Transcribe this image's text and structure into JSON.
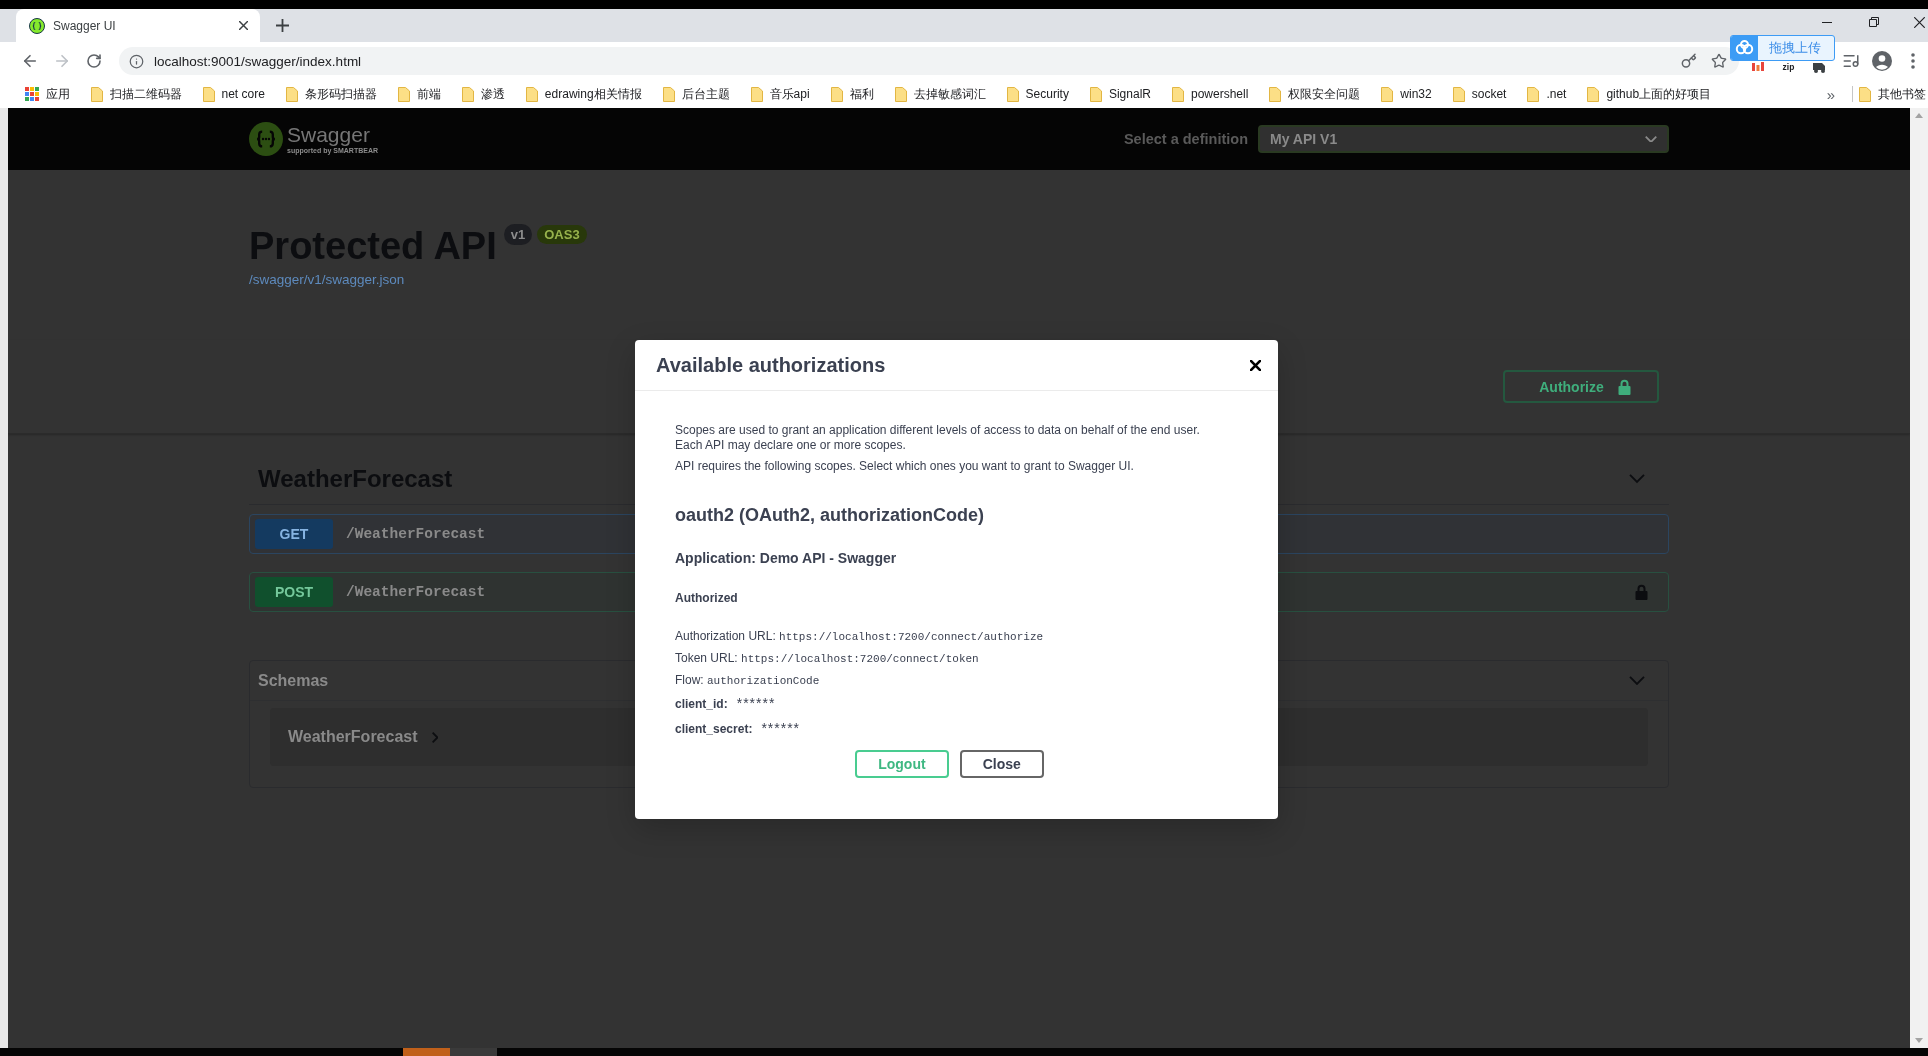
{
  "browser": {
    "tabs": [
      {
        "title": "Swagger UI",
        "selected": true
      }
    ],
    "url": "localhost:9001/swagger/index.html",
    "extension_label": "zip",
    "upload_widget": {
      "label": "拖拽上传"
    }
  },
  "bookmarks": {
    "items": [
      {
        "label": "应用",
        "kind": "apps"
      },
      {
        "label": "扫描二维码器",
        "kind": "folder"
      },
      {
        "label": "net core",
        "kind": "folder"
      },
      {
        "label": "条形码扫描器",
        "kind": "folder"
      },
      {
        "label": "前端",
        "kind": "folder"
      },
      {
        "label": "渗透",
        "kind": "folder"
      },
      {
        "label": "edrawing相关情报",
        "kind": "folder"
      },
      {
        "label": "后台主题",
        "kind": "folder"
      },
      {
        "label": "音乐api",
        "kind": "folder"
      },
      {
        "label": "福利",
        "kind": "folder"
      },
      {
        "label": "去掉敏感词汇",
        "kind": "folder"
      },
      {
        "label": "Security",
        "kind": "folder"
      },
      {
        "label": "SignalR",
        "kind": "folder"
      },
      {
        "label": "powershell",
        "kind": "folder"
      },
      {
        "label": "权限安全问题",
        "kind": "folder"
      },
      {
        "label": "win32",
        "kind": "folder"
      },
      {
        "label": "socket",
        "kind": "folder"
      },
      {
        "label": ".net",
        "kind": "folder"
      },
      {
        "label": "github上面的好项目",
        "kind": "folder"
      }
    ],
    "overflow": "»",
    "other": {
      "label": "其他书签",
      "kind": "folder"
    }
  },
  "swagger": {
    "topbar": {
      "logo_text": "Swagger",
      "logo_tagline": "supported by SMARTBEAR",
      "definition_label": "Select a definition",
      "definition_value": "My API V1"
    },
    "info": {
      "title": "Protected API",
      "version": "v1",
      "spec": "OAS3",
      "spec_url": "/swagger/v1/swagger.json"
    },
    "authorize_button": {
      "label": "Authorize"
    },
    "tags": [
      {
        "name": "WeatherForecast",
        "expanded": true,
        "operations": [
          {
            "kind": "get",
            "method": "GET",
            "path": "/WeatherForecast",
            "locked": false
          },
          {
            "kind": "post",
            "method": "POST",
            "path": "/WeatherForecast",
            "locked": true
          }
        ]
      }
    ],
    "schemas": {
      "title": "Schemas",
      "expanded": true,
      "models": [
        {
          "name": "WeatherForecast",
          "expanded": false
        }
      ]
    }
  },
  "modal": {
    "title": "Available authorizations",
    "paragraphs": [
      {
        "lines": [
          "Scopes are used to grant an application different levels of access to data on behalf of the end user.",
          "Each API may declare one or more scopes."
        ]
      },
      {
        "lines": [
          "API requires the following scopes. Select which ones you want to grant to Swagger UI."
        ]
      }
    ],
    "scheme": {
      "heading": "oauth2 (OAuth2, authorizationCode)",
      "application": "Application: Demo API - Swagger",
      "status": "Authorized",
      "details": [
        {
          "kind": "code",
          "label": "Authorization URL:",
          "value": "https://localhost:7200/connect/authorize"
        },
        {
          "kind": "code",
          "label": "Token URL:",
          "value": "https://localhost:7200/connect/token"
        },
        {
          "kind": "code",
          "label": "Flow:",
          "value": "authorizationCode"
        },
        {
          "kind": "secret",
          "label": "client_id:",
          "value": "******"
        },
        {
          "kind": "secret",
          "label": "client_secret:",
          "value": "******"
        }
      ]
    },
    "buttons": [
      {
        "label": "Logout",
        "kind": "primary"
      },
      {
        "label": "Close",
        "kind": "secondary"
      }
    ]
  },
  "taskbar": {
    "items": [
      {
        "selected": true
      },
      {
        "selected": false
      }
    ]
  }
}
